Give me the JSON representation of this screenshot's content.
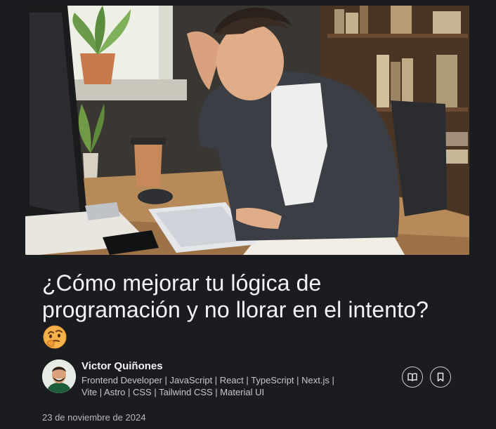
{
  "article": {
    "title": "¿Cómo mejorar tu lógica de programación y no llorar en el intento?",
    "title_emoji": "thinking-face-emoji",
    "cover_image": "stressed-programmer-at-desk-illustration",
    "author": {
      "name": "Victor Quiñones",
      "bio": "Frontend Developer | JavaScript | React | TypeScript | Next.js | Vite | Astro | CSS | Tailwind CSS | Material UI",
      "avatar": "smiling-man-with-beard-avatar"
    },
    "actions": {
      "read_icon": "open-book-icon",
      "save_icon": "bookmark-icon"
    },
    "date": "23 de noviembre de 2024"
  },
  "colors": {
    "background": "#1b1c1f",
    "title": "#f3f4f6",
    "text_muted": "#c5c7cc"
  }
}
